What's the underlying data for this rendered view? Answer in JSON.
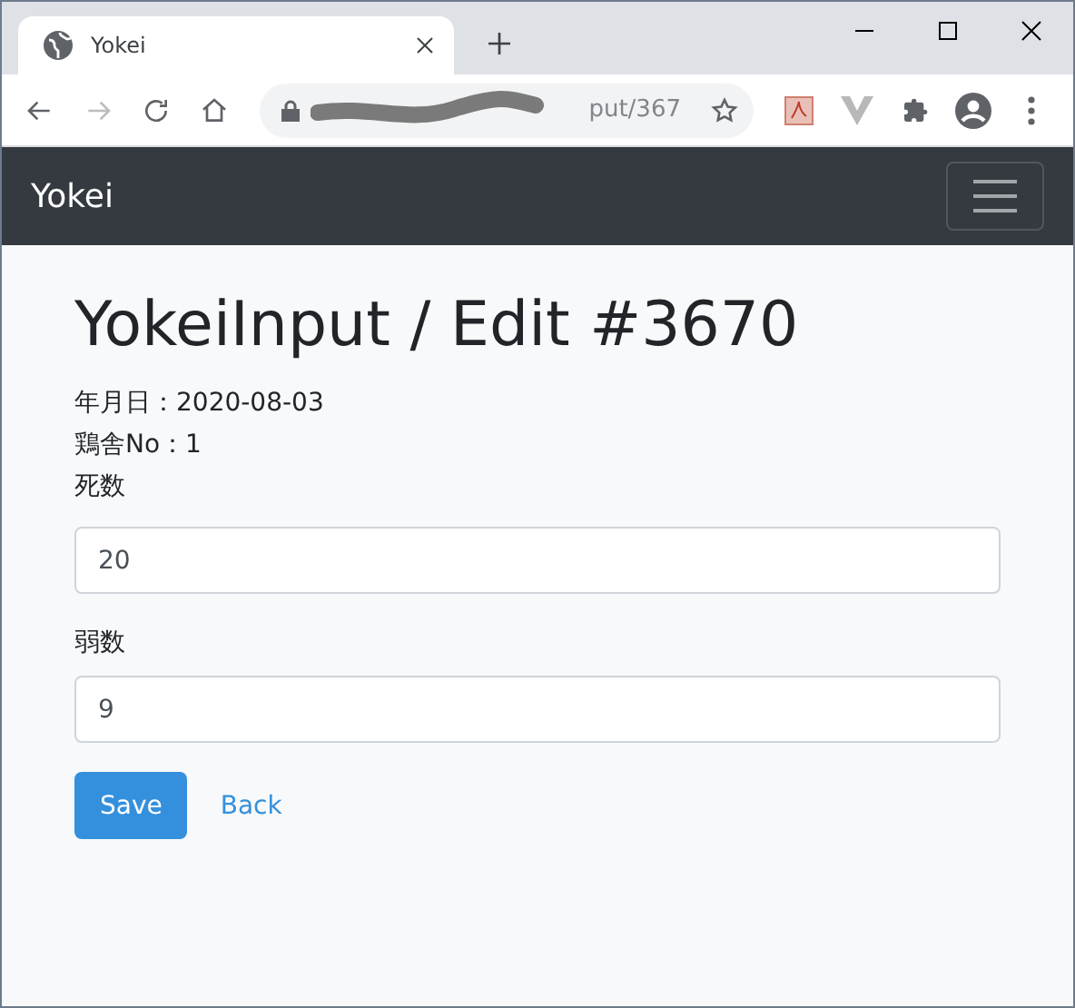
{
  "browser": {
    "tab_title": "Yokei",
    "address": "put/367"
  },
  "navbar": {
    "brand": "Yokei"
  },
  "page": {
    "heading": "YokeiInput / Edit #3670",
    "info": [
      "年月日：2020-08-03",
      "鶏舎No：1"
    ],
    "fields": [
      {
        "label": "死数",
        "value": "20"
      },
      {
        "label": "弱数",
        "value": "9"
      }
    ],
    "buttons": [
      {
        "kind": "primary",
        "label": "Save"
      },
      {
        "kind": "link",
        "label": "Back"
      }
    ]
  }
}
